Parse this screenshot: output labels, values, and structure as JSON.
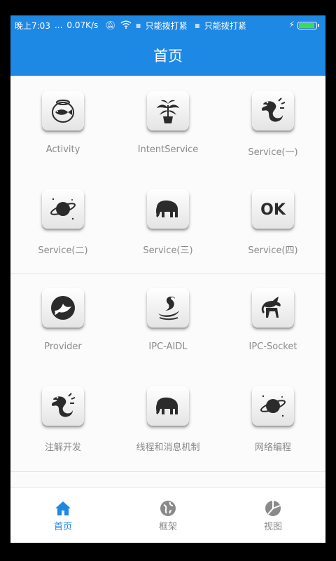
{
  "status_bar": {
    "time": "晚上7:03",
    "dots": "...",
    "speed": "0.07K/s",
    "carrier1": "只能拨打紧",
    "carrier2": "只能拨打紧"
  },
  "appbar": {
    "title": "首页"
  },
  "grid": {
    "items": [
      {
        "label": "Activity",
        "icon": "fishbowl-icon"
      },
      {
        "label": "IntentService",
        "icon": "plant-icon"
      },
      {
        "label": "Service(一)",
        "icon": "dragon-icon"
      },
      {
        "label": "Service(二)",
        "icon": "planet-icon"
      },
      {
        "label": "Service(三)",
        "icon": "elephant-icon"
      },
      {
        "label": "Service(四)",
        "icon": "ok-icon"
      },
      {
        "label": "Provider",
        "icon": "dove-icon"
      },
      {
        "label": "IPC-AIDL",
        "icon": "swan-icon"
      },
      {
        "label": "IPC-Socket",
        "icon": "unicorn-icon"
      },
      {
        "label": "注解开发",
        "icon": "dragon-icon"
      },
      {
        "label": "线程和消息机制",
        "icon": "elephant-icon"
      },
      {
        "label": "网络编程",
        "icon": "planet-icon"
      }
    ],
    "ok_text": "OK"
  },
  "tabbar": {
    "tabs": [
      {
        "label": "首页",
        "icon": "home-icon",
        "active": true
      },
      {
        "label": "框架",
        "icon": "globe-icon",
        "active": false
      },
      {
        "label": "视图",
        "icon": "pie-chart-icon",
        "active": false
      }
    ]
  },
  "colors": {
    "primary": "#1e88e5",
    "label_gray": "#8a8a8a",
    "tile_dark": "#2b2b2b"
  }
}
